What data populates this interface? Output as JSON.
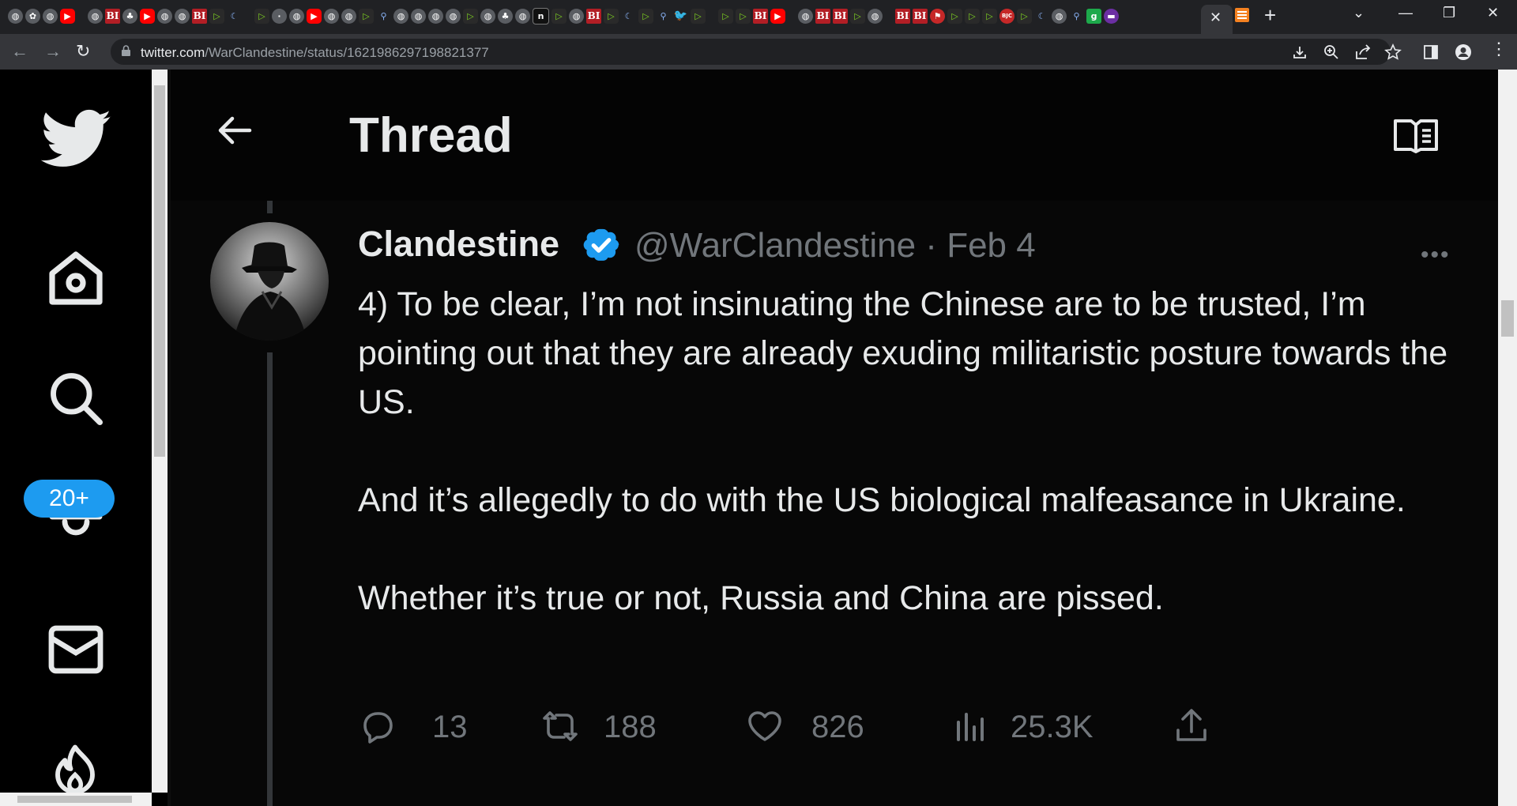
{
  "browser": {
    "url_domain": "twitter.com",
    "url_path": "/WarClandestine/status/1621986297198821377",
    "tab_icons": [
      "globe",
      "game",
      "globe",
      "yt",
      "sep",
      "globe",
      "bi",
      "tree",
      "yt",
      "globe",
      "globe",
      "bi",
      "play",
      "moon",
      "sep",
      "play",
      "dot",
      "globe",
      "yt",
      "globe",
      "globe",
      "play",
      "search",
      "globe",
      "globe",
      "globe",
      "globe",
      "play",
      "globe",
      "tree",
      "globe",
      "n",
      "play",
      "globe",
      "bi",
      "play",
      "moon",
      "play",
      "search",
      "tw",
      "play",
      "sep",
      "play",
      "play",
      "bi",
      "yt",
      "sep",
      "globe",
      "bi",
      "bi",
      "play",
      "globe",
      "sep",
      "bi",
      "bi",
      "flag",
      "play",
      "play",
      "play",
      "bjc",
      "play",
      "moon",
      "globe",
      "search",
      "g",
      "purple"
    ],
    "colors": {
      "chrome_dark": "#202124",
      "chrome_mid": "#35363a"
    }
  },
  "sidebar": {
    "items": [
      {
        "icon": "twitter-logo-icon"
      },
      {
        "icon": "home-icon"
      },
      {
        "icon": "search-icon"
      },
      {
        "icon": "bell-icon"
      },
      {
        "icon": "mail-icon"
      },
      {
        "icon": "fire-icon"
      }
    ],
    "notification_badge": "20+"
  },
  "header": {
    "title": "Thread"
  },
  "tweet": {
    "author_name": "Clandestine",
    "handle": "@WarClandestine",
    "separator": "·",
    "date": "Feb 4",
    "more": "•••",
    "paragraphs": [
      "4) To be clear, I’m not insinuating the Chinese are to be trusted, I’m pointing out that they are already exuding militaristic posture towards the US.",
      "And it’s allegedly to do with the US biological malfeasance in Ukraine.",
      "Whether it’s true or not, Russia and China are pissed."
    ],
    "replies": "13",
    "retweets": "188",
    "likes": "826",
    "views": "25.3K",
    "colors": {
      "verified": "#1d9bf0",
      "muted": "#71767b",
      "text": "#e7e9ea",
      "badge": "#1d9bf0"
    }
  }
}
